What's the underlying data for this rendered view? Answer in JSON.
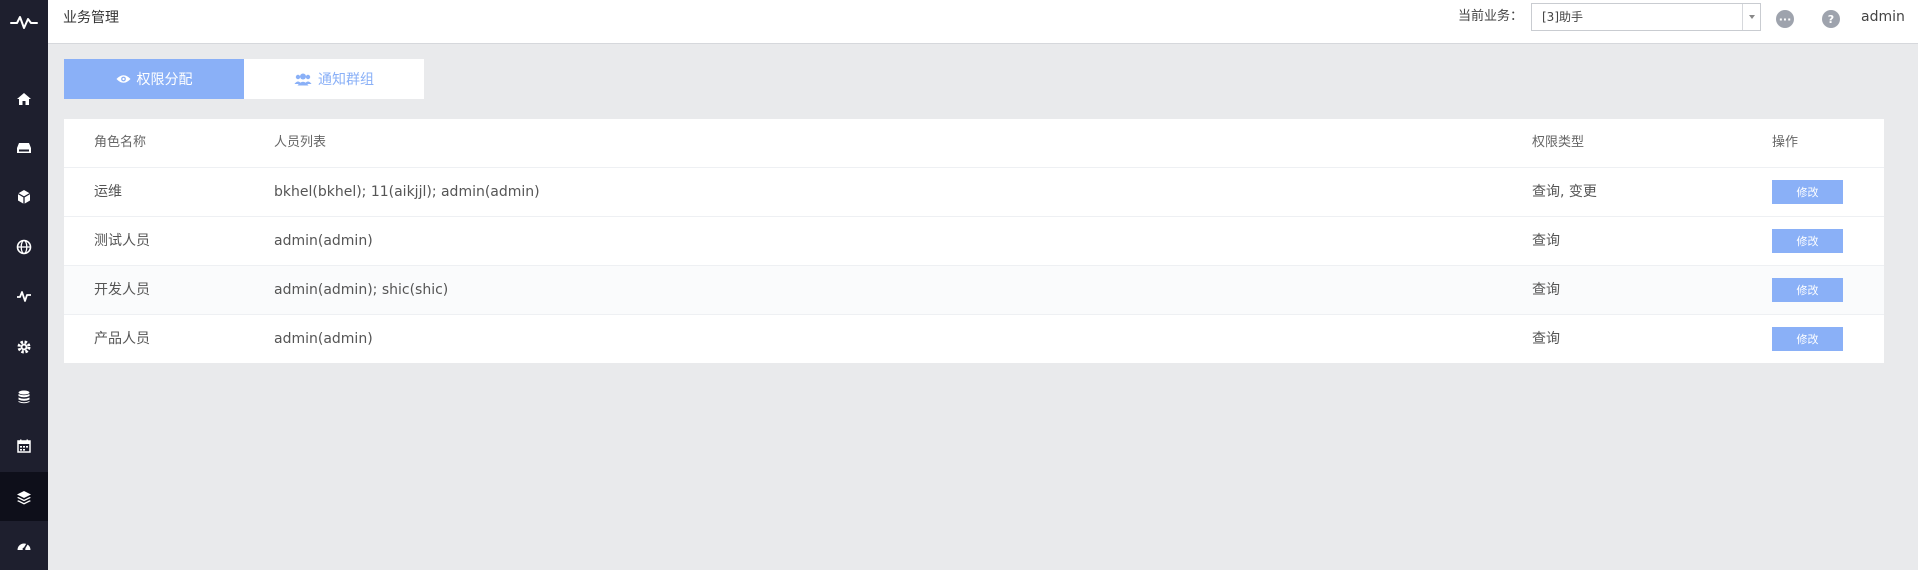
{
  "header": {
    "page_title": "业务管理",
    "biz_label": "当前业务：",
    "biz_select_value": "[3]助手",
    "user": "admin"
  },
  "sidebar": {
    "items": [
      {
        "icon": "home-icon"
      },
      {
        "icon": "storage-icon"
      },
      {
        "icon": "box-icon"
      },
      {
        "icon": "globe-icon"
      },
      {
        "icon": "monitor-icon"
      },
      {
        "icon": "gear-icon"
      },
      {
        "icon": "database-icon"
      },
      {
        "icon": "calendar-icon"
      },
      {
        "icon": "layers-icon",
        "active": true
      },
      {
        "icon": "dashboard-icon"
      }
    ]
  },
  "tabs": [
    {
      "label": "权限分配",
      "icon": "eye-icon",
      "active": true
    },
    {
      "label": "通知群组",
      "icon": "users-icon",
      "active": false
    }
  ],
  "table": {
    "headers": [
      "角色名称",
      "人员列表",
      "权限类型",
      "操作"
    ],
    "rows": [
      {
        "role": "运维",
        "members": "bkhel(bkhel); 11(aikjjl); admin(admin)",
        "perm": "查询, 变更",
        "action": "修改"
      },
      {
        "role": "测试人员",
        "members": "admin(admin)",
        "perm": "查询",
        "action": "修改"
      },
      {
        "role": "开发人员",
        "members": "admin(admin); shic(shic)",
        "perm": "查询",
        "action": "修改"
      },
      {
        "role": "产品人员",
        "members": "admin(admin)",
        "perm": "查询",
        "action": "修改"
      }
    ]
  },
  "colors": {
    "sidebar_bg": "#1e1f2e",
    "accent": "#8ab0f7",
    "page_bg": "#e9eaec"
  }
}
